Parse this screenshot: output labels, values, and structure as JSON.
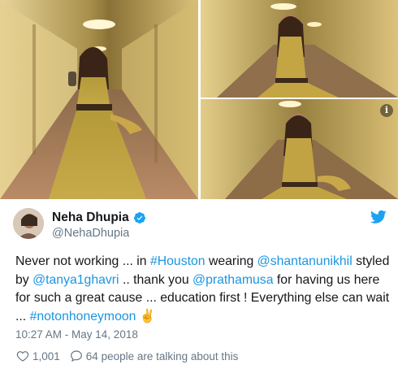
{
  "photos": {
    "info_label": "i",
    "count": 3
  },
  "author": {
    "display_name": "Neha Dhupia",
    "handle": "@NehaDhupia",
    "verified": true
  },
  "tweet": {
    "segments": [
      {
        "text": "Never not working ... in ",
        "type": "text"
      },
      {
        "text": "#Houston",
        "type": "link"
      },
      {
        "text": " wearing ",
        "type": "text"
      },
      {
        "text": "@shantanunikhil",
        "type": "link"
      },
      {
        "text": " styled by ",
        "type": "text"
      },
      {
        "text": "@tanya1ghavri",
        "type": "link"
      },
      {
        "text": " .. thank you ",
        "type": "text"
      },
      {
        "text": "@prathamusa",
        "type": "link"
      },
      {
        "text": " for having us here for such a great cause ... education first ! Everything else can wait ... ",
        "type": "text"
      },
      {
        "text": "#notonhoneymoon",
        "type": "link"
      },
      {
        "text": " ✌️",
        "type": "text"
      }
    ]
  },
  "timestamp": "10:27 AM - May 14, 2018",
  "actions": {
    "likes": "1,001",
    "replies": "64 people are talking about this"
  },
  "colors": {
    "link": "#1b95e0",
    "twitter_blue": "#1da1f2",
    "secondary_text": "#657786"
  },
  "icons": [
    "info-icon",
    "verified-badge-icon",
    "twitter-bird-icon",
    "heart-icon",
    "speech-bubble-icon"
  ]
}
